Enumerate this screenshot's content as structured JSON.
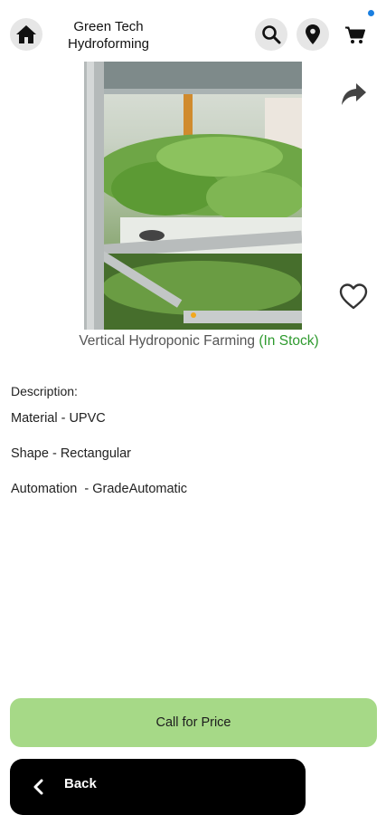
{
  "header": {
    "brand_line1": "Green Tech",
    "brand_line2": "Hydroforming",
    "icons": [
      "home-icon",
      "search-icon",
      "location-pin-icon",
      "cart-icon",
      "notification-dot"
    ],
    "notification_color": "#1a7fe0"
  },
  "product": {
    "title": "Vertical Hydroponic  Farming",
    "stock": "(In Stock)",
    "stock_color": "#2e9a2e",
    "image": "hydroponic-rack-photo",
    "carousel_active_color": "#f2a81d"
  },
  "description": {
    "label": "Description:",
    "specs": [
      "Material - UPVC",
      "Shape - Rectangular",
      "Automation  - GradeAutomatic"
    ]
  },
  "actions": {
    "call_label": "Call for Price",
    "call_color": "#a6d987",
    "back_label": "Back"
  }
}
